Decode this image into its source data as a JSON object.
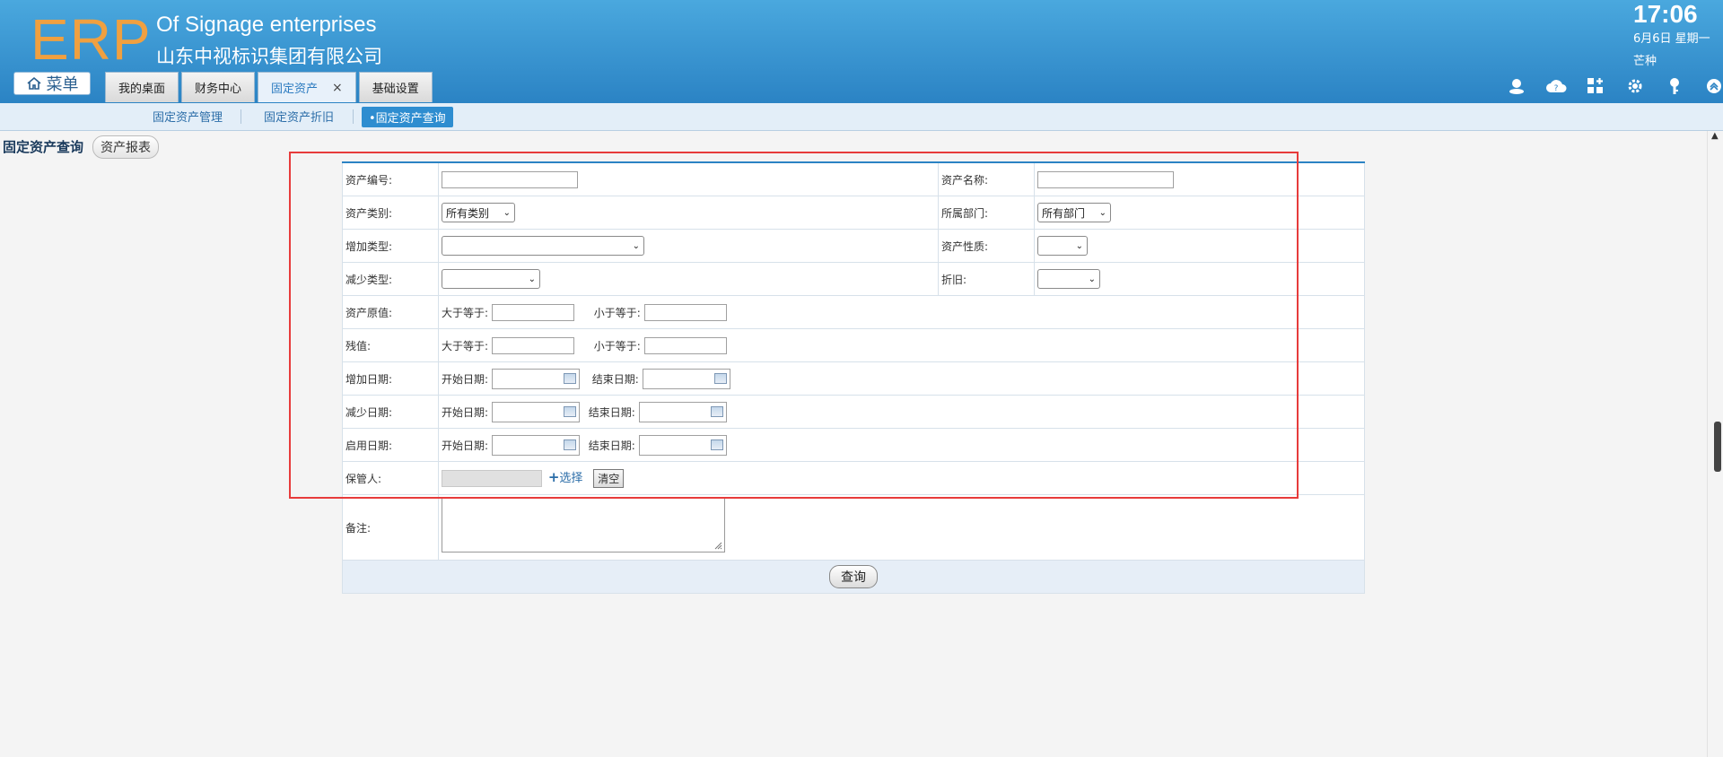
{
  "header": {
    "logo": "ERP",
    "company_en": "Of Signage enterprises",
    "company_cn": "山东中视标识集团有限公司",
    "clock": "17:06",
    "date": "6月6日 星期一",
    "solar_term": "芒种",
    "menu_label": "菜单",
    "tabs": [
      "我的桌面",
      "财务中心",
      "固定资产",
      "基础设置"
    ],
    "active_tab_close": "×"
  },
  "subnav": {
    "items": [
      "固定资产管理",
      "固定资产折旧"
    ],
    "active": "•固定资产查询"
  },
  "page": {
    "title": "固定资产查询",
    "report_button": "资产报表"
  },
  "form": {
    "asset_no": "资产编号:",
    "asset_name": "资产名称:",
    "asset_category": "资产类别:",
    "category_value": "所有类别",
    "department": "所属部门:",
    "department_value": "所有部门",
    "increase_type": "增加类型:",
    "asset_nature": "资产性质:",
    "decrease_type": "减少类型:",
    "depreciation": "折旧:",
    "original_value": "资产原值:",
    "residual_value": "残值:",
    "gte": "大于等于:",
    "lte": "小于等于:",
    "increase_date": "增加日期:",
    "decrease_date": "减少日期:",
    "enable_date": "启用日期:",
    "start_date": "开始日期:",
    "end_date": "结束日期:",
    "custodian": "保管人:",
    "choose": "选择",
    "clear": "清空",
    "remarks": "备注:",
    "query": "查询"
  }
}
